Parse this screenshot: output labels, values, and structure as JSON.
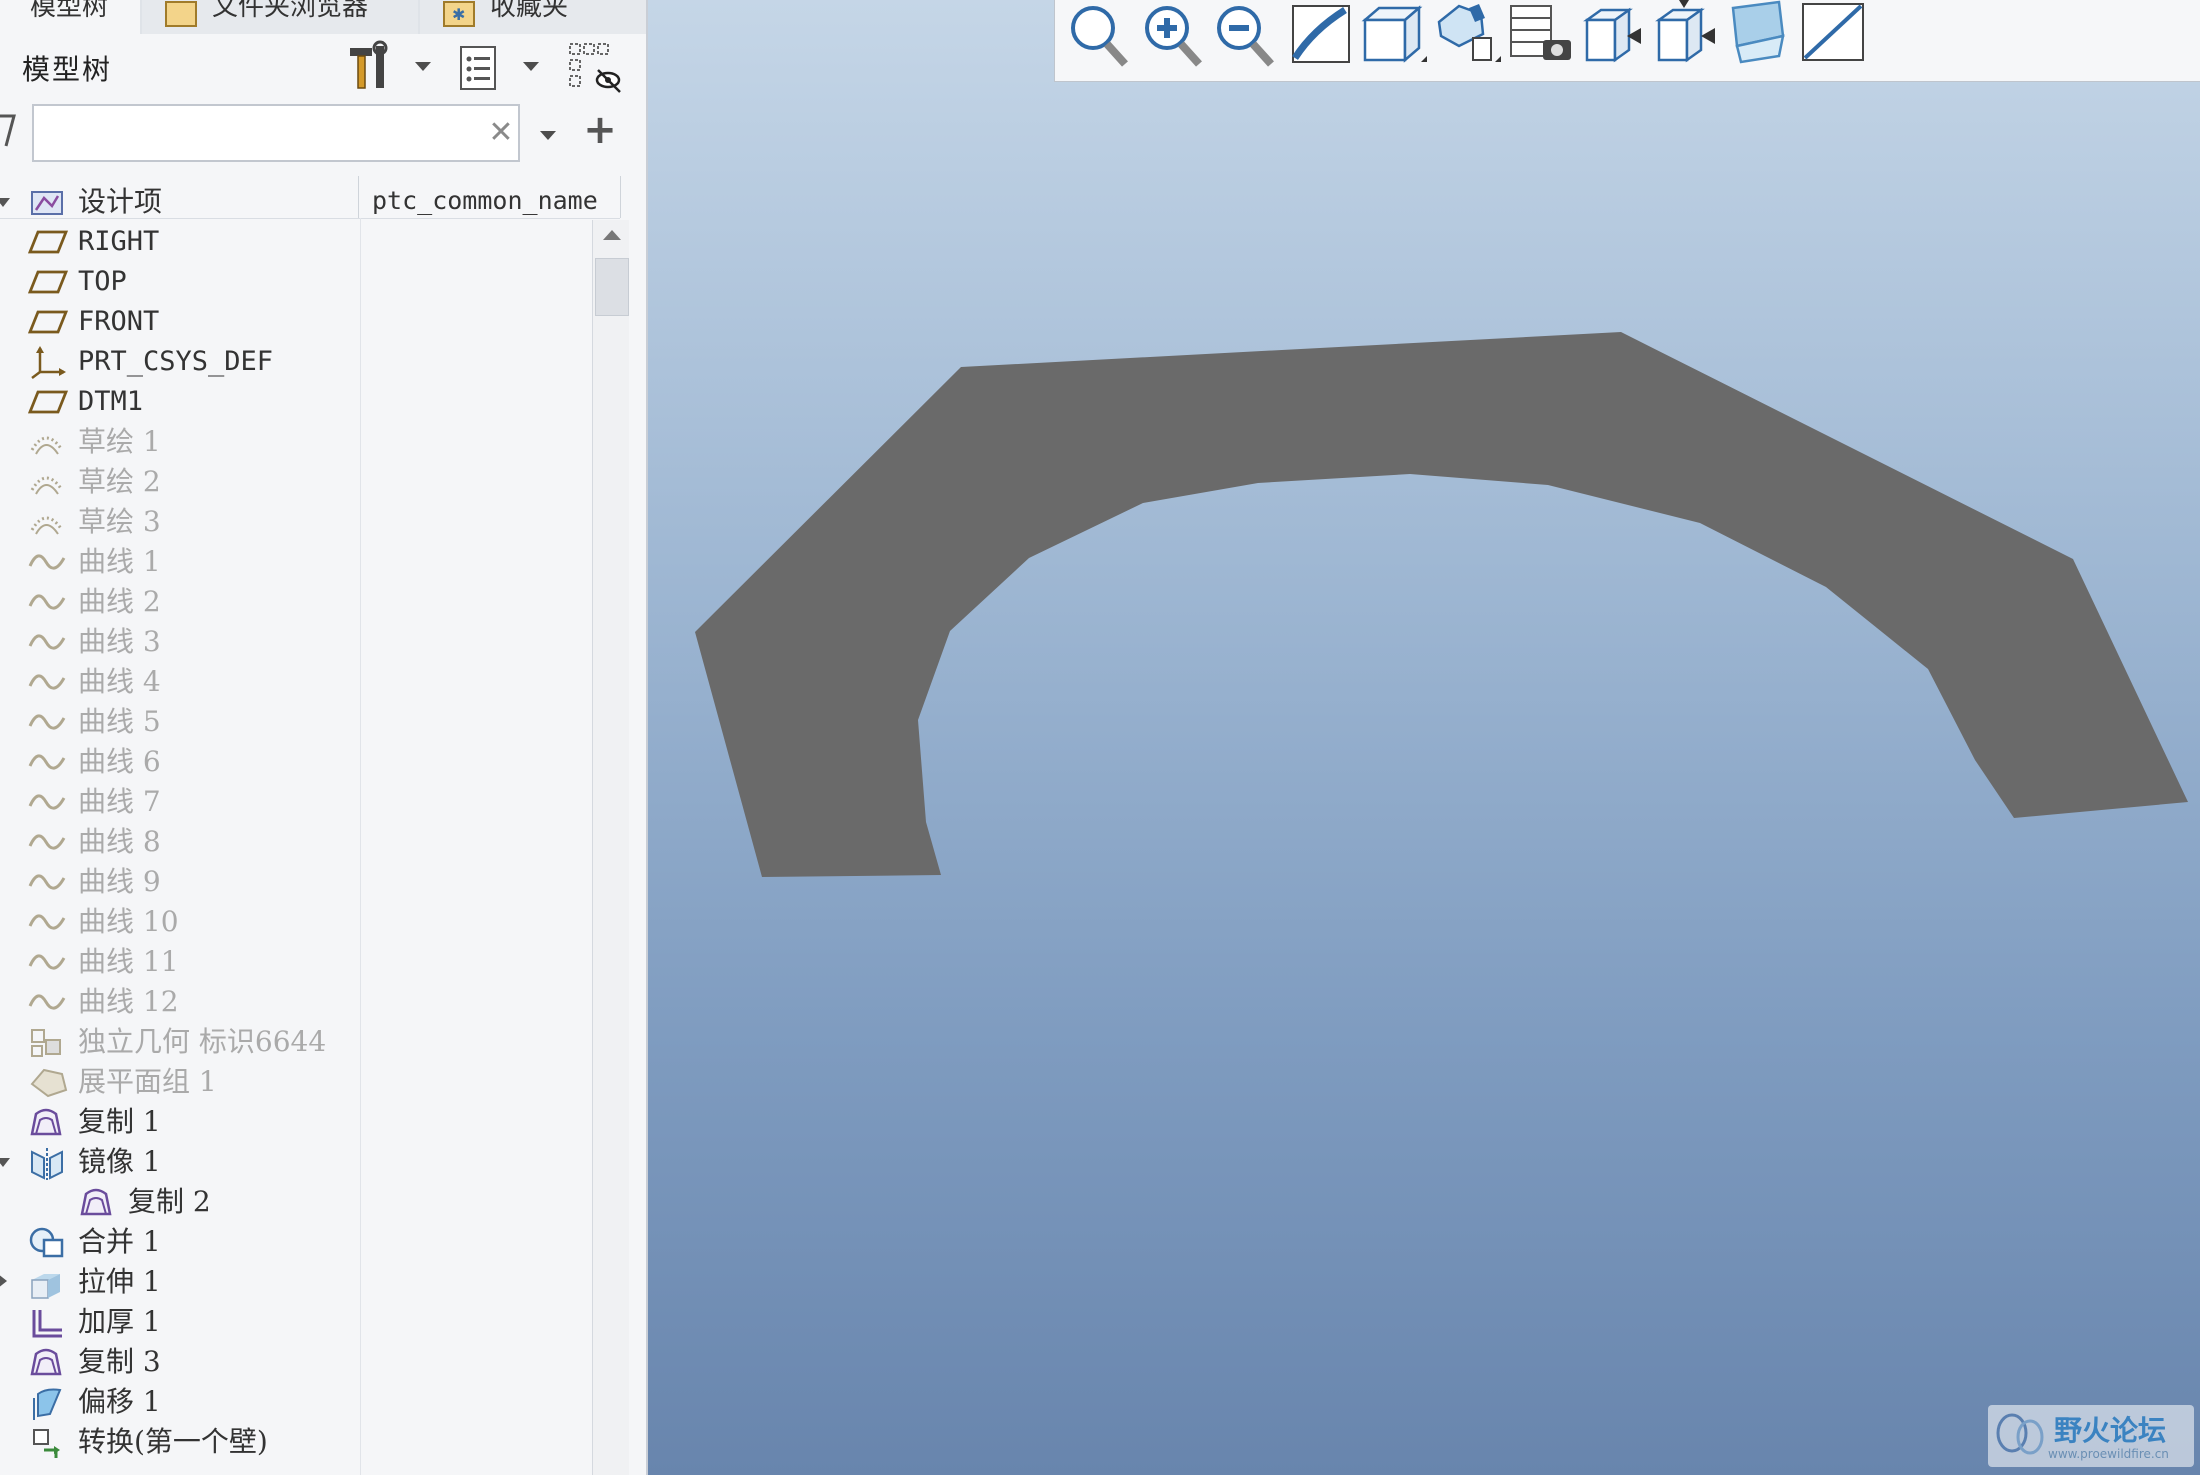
{
  "tabs": [
    {
      "label": "模型树"
    },
    {
      "label": "文件夹浏览器"
    },
    {
      "label": "收藏夹"
    }
  ],
  "panel": {
    "title": "模型树",
    "search_value": "",
    "search_placeholder": "",
    "column_header": "ptc_common_name",
    "clear_symbol": "✕",
    "add_symbol": "+"
  },
  "tree_items": [
    {
      "label": "设计项",
      "icon": "design-items-icon",
      "state": "normal",
      "expander": "expanded"
    },
    {
      "label": "RIGHT",
      "icon": "datum-plane-icon",
      "state": "normal"
    },
    {
      "label": "TOP",
      "icon": "datum-plane-icon",
      "state": "normal"
    },
    {
      "label": "FRONT",
      "icon": "datum-plane-icon",
      "state": "normal"
    },
    {
      "label": "PRT_CSYS_DEF",
      "icon": "coordinate-system-icon",
      "state": "normal"
    },
    {
      "label": "DTM1",
      "icon": "datum-plane-icon",
      "state": "normal"
    },
    {
      "label": "草绘 1",
      "icon": "sketch-icon",
      "state": "suppressed"
    },
    {
      "label": "草绘 2",
      "icon": "sketch-icon",
      "state": "suppressed"
    },
    {
      "label": "草绘 3",
      "icon": "sketch-icon",
      "state": "suppressed"
    },
    {
      "label": "曲线 1",
      "icon": "curve-icon",
      "state": "suppressed"
    },
    {
      "label": "曲线 2",
      "icon": "curve-icon",
      "state": "suppressed"
    },
    {
      "label": "曲线 3",
      "icon": "curve-icon",
      "state": "suppressed"
    },
    {
      "label": "曲线 4",
      "icon": "curve-icon",
      "state": "suppressed"
    },
    {
      "label": "曲线 5",
      "icon": "curve-icon",
      "state": "suppressed"
    },
    {
      "label": "曲线 6",
      "icon": "curve-icon",
      "state": "suppressed"
    },
    {
      "label": "曲线 7",
      "icon": "curve-icon",
      "state": "suppressed"
    },
    {
      "label": "曲线 8",
      "icon": "curve-icon",
      "state": "suppressed"
    },
    {
      "label": "曲线 9",
      "icon": "curve-icon",
      "state": "suppressed"
    },
    {
      "label": "曲线 10",
      "icon": "curve-icon",
      "state": "suppressed"
    },
    {
      "label": "曲线 11",
      "icon": "curve-icon",
      "state": "suppressed"
    },
    {
      "label": "曲线 12",
      "icon": "curve-icon",
      "state": "suppressed"
    },
    {
      "label": "独立几何 标识6644",
      "icon": "independent-geometry-icon",
      "state": "suppressed"
    },
    {
      "label": "展平面组 1",
      "icon": "flatten-quilt-icon",
      "state": "suppressed"
    },
    {
      "label": "复制 1",
      "icon": "copy-surface-icon",
      "state": "normal"
    },
    {
      "label": "镜像 1",
      "icon": "mirror-icon",
      "state": "normal",
      "expander": "expanded"
    },
    {
      "label": "复制 2",
      "icon": "copy-surface-icon",
      "state": "normal",
      "child": true
    },
    {
      "label": "合并 1",
      "icon": "merge-icon",
      "state": "normal"
    },
    {
      "label": "拉伸 1",
      "icon": "extrude-icon",
      "state": "normal",
      "expander": "collapsed"
    },
    {
      "label": "加厚 1",
      "icon": "thicken-icon",
      "state": "normal"
    },
    {
      "label": "复制 3",
      "icon": "copy-surface-icon",
      "state": "normal"
    },
    {
      "label": "偏移 1",
      "icon": "offset-icon",
      "state": "normal"
    },
    {
      "label": "转换(第一个壁)",
      "icon": "convert-wall-icon",
      "state": "normal"
    }
  ],
  "view_toolbar": [
    {
      "icon": "refit-icon"
    },
    {
      "icon": "zoom-in-icon"
    },
    {
      "icon": "zoom-out-icon"
    },
    {
      "icon": "repaint-icon"
    },
    {
      "icon": "display-style-icon"
    },
    {
      "icon": "saved-orientations-icon"
    },
    {
      "icon": "view-manager-icon"
    },
    {
      "icon": "datum-display-icon"
    },
    {
      "icon": "annotation-display-icon"
    },
    {
      "icon": "perspective-view-icon"
    },
    {
      "icon": "spin-center-icon"
    }
  ],
  "watermark": {
    "text": "野火论坛",
    "url": "www.proewildfire.cn"
  },
  "colors": {
    "part_fill": "#6a6a6a",
    "suppressed_text": "#aaaaaa",
    "datum_icon": "#7a5a1e",
    "feature_icon": "#6a4c9c",
    "accent_blue": "#3b83c1"
  }
}
